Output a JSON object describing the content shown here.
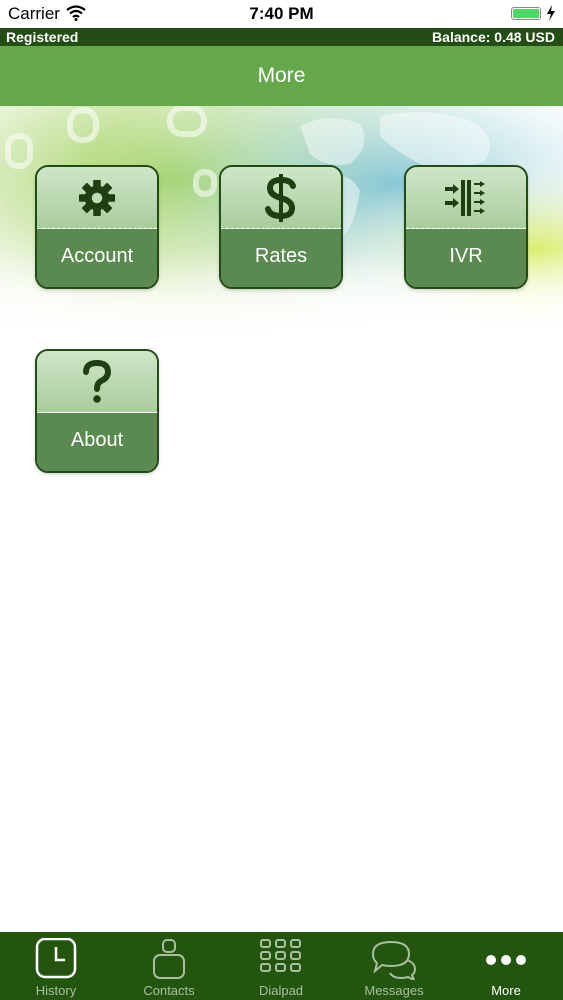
{
  "status_bar": {
    "carrier": "Carrier",
    "time": "7:40 PM"
  },
  "registration_bar": {
    "status": "Registered",
    "balance": "Balance: 0.48 USD"
  },
  "nav": {
    "title": "More"
  },
  "menu": {
    "account": "Account",
    "rates": "Rates",
    "ivr": "IVR",
    "about": "About"
  },
  "tabs": {
    "history": "History",
    "contacts": "Contacts",
    "dialpad": "Dialpad",
    "messages": "Messages",
    "more": "More",
    "active": "more"
  },
  "colors": {
    "nav_green": "#65a84b",
    "dark_green": "#234d14",
    "tile_bottom": "#5a8a4f",
    "tab_active": "#ffffff",
    "tab_inactive": "#a8bfa0"
  }
}
